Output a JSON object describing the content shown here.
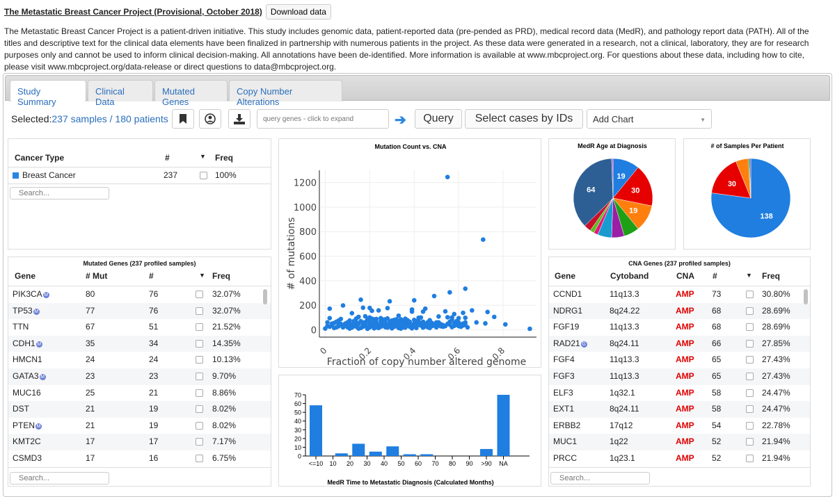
{
  "header": {
    "title": "The Metastatic Breast Cancer Project (Provisional, October 2018)",
    "download_label": "Download data",
    "description": "The Metastatic Breast Cancer Project is a patient-driven initiative. This study includes genomic data, patient-reported data (pre-pended as PRD), medical record data (MedR), and pathology report data (PATH). All of the titles and descriptive text for the clinical data elements have been finalized in partnership with numerous patients in the project. As these data were generated in a research, not a clinical, laboratory, they are for research purposes only and cannot be used to inform clinical decision-making. All annotations have been de-identified. More information is available at www.mbcproject.org. For questions about these data, including how to cite, please visit www.mbcproject.org/data-release or direct questions to data@mbcproject.org."
  },
  "tabs": [
    {
      "label": "Study Summary",
      "active": true
    },
    {
      "label": "Clinical Data",
      "active": false
    },
    {
      "label": "Mutated Genes",
      "active": false
    },
    {
      "label": "Copy Number Alterations",
      "active": false
    }
  ],
  "toolbar": {
    "selected_label": "Selected:",
    "selected_value": "237 samples / 180 patients",
    "query_placeholder": "query genes - click to expand",
    "query_label": "Query",
    "select_cases_label": "Select cases by IDs",
    "add_chart_label": "Add Chart",
    "icons": [
      "bookmark-icon",
      "user-circle-icon",
      "download-icon",
      "arrow-right-icon"
    ]
  },
  "cancer_type_table": {
    "headers": [
      "Cancer Type",
      "#",
      "Freq"
    ],
    "rows": [
      {
        "name": "Breast Cancer",
        "count": "237",
        "freq": "100%",
        "color": "#2986e2"
      }
    ],
    "search_placeholder": "Search..."
  },
  "mutated_genes": {
    "title": "Mutated Genes (237 profiled samples)",
    "headers": [
      "Gene",
      "# Mut",
      "#",
      "Freq"
    ],
    "rows": [
      {
        "gene": "PIK3CA",
        "badge": "M",
        "mut": "80",
        "n": "76",
        "freq": "32.07%"
      },
      {
        "gene": "TP53",
        "badge": "M",
        "mut": "77",
        "n": "76",
        "freq": "32.07%"
      },
      {
        "gene": "TTN",
        "badge": "",
        "mut": "67",
        "n": "51",
        "freq": "21.52%"
      },
      {
        "gene": "CDH1",
        "badge": "M",
        "mut": "35",
        "n": "34",
        "freq": "14.35%"
      },
      {
        "gene": "HMCN1",
        "badge": "",
        "mut": "24",
        "n": "24",
        "freq": "10.13%"
      },
      {
        "gene": "GATA3",
        "badge": "M",
        "mut": "23",
        "n": "23",
        "freq": "9.70%"
      },
      {
        "gene": "MUC16",
        "badge": "",
        "mut": "25",
        "n": "21",
        "freq": "8.86%"
      },
      {
        "gene": "DST",
        "badge": "",
        "mut": "21",
        "n": "19",
        "freq": "8.02%"
      },
      {
        "gene": "PTEN",
        "badge": "M",
        "mut": "21",
        "n": "19",
        "freq": "8.02%"
      },
      {
        "gene": "KMT2C",
        "badge": "",
        "mut": "17",
        "n": "17",
        "freq": "7.17%"
      },
      {
        "gene": "CSMD3",
        "badge": "",
        "mut": "17",
        "n": "16",
        "freq": "6.75%"
      }
    ],
    "search_placeholder": "Search..."
  },
  "cna_genes": {
    "title": "CNA Genes (237 profiled samples)",
    "headers": [
      "Gene",
      "Cytoband",
      "CNA",
      "#",
      "Freq"
    ],
    "rows": [
      {
        "gene": "CCND1",
        "badge": "",
        "cytoband": "11q13.3",
        "cna": "AMP",
        "n": "73",
        "freq": "30.80%"
      },
      {
        "gene": "NDRG1",
        "badge": "",
        "cytoband": "8q24.22",
        "cna": "AMP",
        "n": "68",
        "freq": "28.69%"
      },
      {
        "gene": "FGF19",
        "badge": "",
        "cytoband": "11q13.3",
        "cna": "AMP",
        "n": "68",
        "freq": "28.69%"
      },
      {
        "gene": "RAD21",
        "badge": "G",
        "cytoband": "8q24.11",
        "cna": "AMP",
        "n": "66",
        "freq": "27.85%"
      },
      {
        "gene": "FGF4",
        "badge": "",
        "cytoband": "11q13.3",
        "cna": "AMP",
        "n": "65",
        "freq": "27.43%"
      },
      {
        "gene": "FGF3",
        "badge": "",
        "cytoband": "11q13.3",
        "cna": "AMP",
        "n": "65",
        "freq": "27.43%"
      },
      {
        "gene": "ELF3",
        "badge": "",
        "cytoband": "1q32.1",
        "cna": "AMP",
        "n": "58",
        "freq": "24.47%"
      },
      {
        "gene": "EXT1",
        "badge": "",
        "cytoband": "8q24.11",
        "cna": "AMP",
        "n": "58",
        "freq": "24.47%"
      },
      {
        "gene": "ERBB2",
        "badge": "",
        "cytoband": "17q12",
        "cna": "AMP",
        "n": "54",
        "freq": "22.78%"
      },
      {
        "gene": "MUC1",
        "badge": "",
        "cytoband": "1q22",
        "cna": "AMP",
        "n": "52",
        "freq": "21.94%"
      },
      {
        "gene": "PRCC",
        "badge": "",
        "cytoband": "1q23.1",
        "cna": "AMP",
        "n": "52",
        "freq": "21.94%"
      }
    ],
    "search_placeholder": "Search..."
  },
  "chart_data": [
    {
      "type": "scatter",
      "title": "Mutation Count vs. CNA",
      "xlabel": "Fraction of copy number altered genome",
      "ylabel": "# of mutations",
      "xlim": [
        -0.02,
        0.95
      ],
      "ylim": [
        -60,
        1300
      ],
      "xticks": [
        "0",
        "0.2",
        "0.4",
        "0.6",
        "0.8"
      ],
      "yticks": [
        "0",
        "200",
        "400",
        "600",
        "800",
        "1000",
        "1200"
      ],
      "grid": true,
      "color": "#1f7ee0",
      "points": [
        [
          0.55,
          1245
        ],
        [
          0.71,
          735
        ],
        [
          0.63,
          335
        ],
        [
          0.56,
          305
        ],
        [
          0.49,
          275
        ],
        [
          0.16,
          245
        ],
        [
          0.4,
          240
        ],
        [
          0.29,
          232
        ],
        [
          0.08,
          198
        ],
        [
          0.02,
          172
        ],
        [
          0.17,
          180
        ],
        [
          0.2,
          178
        ],
        [
          0.28,
          176
        ],
        [
          0.24,
          158
        ],
        [
          0.45,
          172
        ],
        [
          0.44,
          148
        ],
        [
          0.54,
          150
        ],
        [
          0.66,
          158
        ],
        [
          0.73,
          145
        ],
        [
          0.62,
          138
        ],
        [
          0.76,
          105
        ],
        [
          0.68,
          60
        ],
        [
          0.72,
          52
        ],
        [
          0.81,
          44
        ],
        [
          0.92,
          8
        ],
        [
          0.21,
          155
        ],
        [
          0.12,
          135
        ],
        [
          0.39,
          148
        ],
        [
          0.39,
          165
        ],
        [
          0.02,
          95
        ],
        [
          0.58,
          128
        ],
        [
          0.51,
          108
        ],
        [
          0.55,
          102
        ],
        [
          0.57,
          100
        ],
        [
          0.6,
          95
        ],
        [
          0.63,
          98
        ],
        [
          0.14,
          92
        ],
        [
          0.07,
          88
        ],
        [
          0.33,
          115
        ],
        [
          0.36,
          90
        ],
        [
          0.42,
          98
        ],
        [
          0.47,
          78
        ],
        [
          0.03,
          50
        ],
        [
          0.05,
          65
        ],
        [
          0.1,
          55
        ],
        [
          0.13,
          72
        ],
        [
          0.15,
          48
        ],
        [
          0.18,
          62
        ],
        [
          0.19,
          85
        ],
        [
          0.22,
          70
        ],
        [
          0.23,
          45
        ],
        [
          0.25,
          95
        ],
        [
          0.26,
          58
        ],
        [
          0.27,
          40
        ],
        [
          0.3,
          75
        ],
        [
          0.31,
          52
        ],
        [
          0.32,
          30
        ],
        [
          0.34,
          68
        ],
        [
          0.35,
          42
        ],
        [
          0.37,
          55
        ],
        [
          0.38,
          25
        ],
        [
          0.41,
          60
        ],
        [
          0.43,
          35
        ],
        [
          0.46,
          50
        ],
        [
          0.48,
          30
        ],
        [
          0.5,
          45
        ],
        [
          0.52,
          28
        ],
        [
          0.54,
          30
        ],
        [
          0.56,
          65
        ],
        [
          0.59,
          40
        ],
        [
          0.61,
          25
        ],
        [
          0.62,
          50
        ],
        [
          0.64,
          20
        ],
        [
          0.0,
          10
        ],
        [
          0.01,
          30
        ],
        [
          0.04,
          15
        ],
        [
          0.06,
          40
        ],
        [
          0.08,
          20
        ],
        [
          0.09,
          35
        ],
        [
          0.11,
          10
        ],
        [
          0.12,
          45
        ],
        [
          0.14,
          25
        ],
        [
          0.16,
          15
        ],
        [
          0.17,
          38
        ],
        [
          0.19,
          22
        ],
        [
          0.2,
          50
        ],
        [
          0.21,
          30
        ],
        [
          0.22,
          12
        ],
        [
          0.24,
          40
        ],
        [
          0.25,
          25
        ],
        [
          0.27,
          60
        ],
        [
          0.28,
          18
        ],
        [
          0.29,
          45
        ],
        [
          0.3,
          28
        ],
        [
          0.31,
          80
        ],
        [
          0.33,
          15
        ],
        [
          0.34,
          40
        ],
        [
          0.35,
          20
        ],
        [
          0.36,
          55
        ],
        [
          0.37,
          35
        ],
        [
          0.39,
          12
        ],
        [
          0.4,
          50
        ],
        [
          0.41,
          28
        ],
        [
          0.42,
          70
        ],
        [
          0.44,
          18
        ],
        [
          0.45,
          40
        ],
        [
          0.46,
          22
        ],
        [
          0.48,
          55
        ],
        [
          0.49,
          35
        ],
        [
          0.5,
          20
        ],
        [
          0.51,
          60
        ],
        [
          0.53,
          38
        ],
        [
          0.57,
          22
        ],
        [
          0.58,
          55
        ],
        [
          0.6,
          30
        ],
        [
          0.61,
          42
        ],
        [
          0.63,
          60
        ],
        [
          0.15,
          105
        ],
        [
          0.18,
          110
        ],
        [
          0.2,
          100
        ],
        [
          0.23,
          88
        ],
        [
          0.26,
          82
        ],
        [
          0.28,
          92
        ],
        [
          0.32,
          85
        ],
        [
          0.03,
          40
        ],
        [
          0.06,
          28
        ],
        [
          0.1,
          60
        ],
        [
          0.13,
          30
        ],
        [
          0.18,
          42
        ],
        [
          0.23,
          62
        ],
        [
          0.26,
          35
        ],
        [
          0.3,
          12
        ],
        [
          0.35,
          70
        ],
        [
          0.38,
          48
        ],
        [
          0.43,
          52
        ],
        [
          0.47,
          15
        ],
        [
          0.52,
          45
        ],
        [
          0.09,
          50
        ],
        [
          0.11,
          75
        ],
        [
          0.14,
          60
        ],
        [
          0.17,
          25
        ],
        [
          0.21,
          90
        ],
        [
          0.24,
          15
        ],
        [
          0.29,
          68
        ],
        [
          0.33,
          45
        ],
        [
          0.36,
          30
        ],
        [
          0.4,
          80
        ],
        [
          0.44,
          65
        ],
        [
          0.05,
          20
        ],
        [
          0.07,
          48
        ],
        [
          0.12,
          18
        ],
        [
          0.16,
          70
        ],
        [
          0.19,
          8
        ],
        [
          0.22,
          35
        ],
        [
          0.25,
          72
        ],
        [
          0.27,
          22
        ],
        [
          0.31,
          40
        ],
        [
          0.34,
          10
        ],
        [
          0.37,
          78
        ],
        [
          0.41,
          15
        ],
        [
          0.43,
          100
        ],
        [
          0.46,
          60
        ],
        [
          0.02,
          25
        ],
        [
          0.04,
          55
        ],
        [
          0.08,
          35
        ],
        [
          0.1,
          22
        ],
        [
          0.13,
          50
        ],
        [
          0.15,
          10
        ],
        [
          0.2,
          65
        ],
        [
          0.22,
          50
        ],
        [
          0.24,
          30
        ],
        [
          0.26,
          50
        ],
        [
          0.28,
          38
        ],
        [
          0.3,
          55
        ],
        [
          0.32,
          60
        ],
        [
          0.35,
          50
        ],
        [
          0.38,
          65
        ],
        [
          0.42,
          42
        ],
        [
          0.45,
          28
        ],
        [
          0.48,
          40
        ],
        [
          0.5,
          60
        ],
        [
          0.53,
          25
        ],
        [
          0.55,
          48
        ],
        [
          0.58,
          32
        ],
        [
          0.6,
          60
        ],
        [
          0.62,
          35
        ],
        [
          0.01,
          60
        ],
        [
          0.06,
          75
        ],
        [
          0.11,
          40
        ],
        [
          0.17,
          58
        ],
        [
          0.21,
          45
        ],
        [
          0.23,
          20
        ],
        [
          0.27,
          85
        ],
        [
          0.29,
          30
        ],
        [
          0.33,
          62
        ],
        [
          0.36,
          18
        ],
        [
          0.39,
          42
        ],
        [
          0.41,
          70
        ],
        [
          0.44,
          38
        ],
        [
          0.47,
          55
        ],
        [
          0.51,
          35
        ],
        [
          0.56,
          42
        ],
        [
          0.59,
          70
        ],
        [
          0.63,
          40
        ],
        [
          0.18,
          30
        ],
        [
          0.2,
          20
        ],
        [
          0.22,
          85
        ],
        [
          0.25,
          45
        ],
        [
          0.31,
          25
        ],
        [
          0.34,
          85
        ],
        [
          0.4,
          32
        ],
        [
          0.46,
          35
        ],
        [
          0.57,
          85
        ]
      ]
    },
    {
      "type": "bar",
      "title": "MedR Time to Metastatic Diagnosis (Calculated Months)",
      "categories": [
        "<=10",
        "10-20",
        "20-30",
        "30-40",
        "40-50",
        "50-60",
        "60-70",
        "70-80",
        "80-90",
        ">90",
        "NA"
      ],
      "xticks": [
        "<=10",
        "10",
        "20",
        "30",
        "40",
        "50",
        "60",
        "70",
        "80",
        "90",
        ">90",
        "NA"
      ],
      "values": [
        58,
        3,
        14,
        5,
        11,
        2,
        2,
        0,
        0,
        8,
        70
      ],
      "yticks": [
        "0",
        "10",
        "20",
        "30",
        "40",
        "50",
        "60",
        "70"
      ],
      "ylim": [
        0,
        70
      ],
      "color": "#1f7ee0"
    },
    {
      "type": "pie",
      "title": "MedR Age at Diagnosis",
      "slices": [
        {
          "label": "19",
          "value": 19,
          "color": "#1f7ee0",
          "show_label": true
        },
        {
          "label": "30",
          "value": 30,
          "color": "#e60000",
          "show_label": true
        },
        {
          "label": "19",
          "value": 19,
          "color": "#ff7f0e",
          "show_label": true
        },
        {
          "label": "",
          "value": 11,
          "color": "#1ea016",
          "show_label": false
        },
        {
          "label": "",
          "value": 9,
          "color": "#9b1ea6",
          "show_label": false
        },
        {
          "label": "",
          "value": 10,
          "color": "#1a9bd0",
          "show_label": false
        },
        {
          "label": "",
          "value": 3,
          "color": "#e8137a",
          "show_label": false
        },
        {
          "label": "",
          "value": 3,
          "color": "#5bc01c",
          "show_label": false
        },
        {
          "label": "",
          "value": 5,
          "color": "#c8102e",
          "show_label": false
        },
        {
          "label": "64",
          "value": 64,
          "color": "#2d5f94",
          "show_label": true
        },
        {
          "label": "",
          "value": 1,
          "color": "#b54cc0",
          "show_label": false
        }
      ]
    },
    {
      "type": "pie",
      "title": "# of Samples Per Patient",
      "slices": [
        {
          "label": "138",
          "value": 138,
          "color": "#1f7ee0",
          "show_label": true
        },
        {
          "label": "30",
          "value": 30,
          "color": "#e60000",
          "show_label": true
        },
        {
          "label": "",
          "value": 9,
          "color": "#ff7f0e",
          "show_label": false
        },
        {
          "label": "",
          "value": 1,
          "color": "#1ea016",
          "show_label": false
        },
        {
          "label": "",
          "value": 1,
          "color": "#7a4fc0",
          "show_label": false
        }
      ]
    }
  ]
}
